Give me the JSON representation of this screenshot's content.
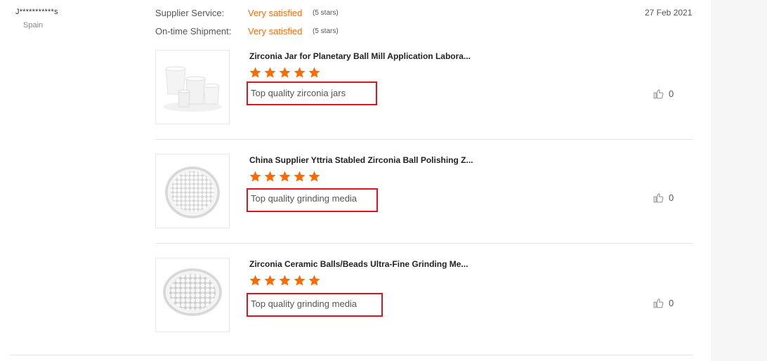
{
  "reviewer": {
    "name": "J***********s",
    "country": "Spain"
  },
  "ratings": [
    {
      "label": "Supplier Service:",
      "value": "Very satisfied",
      "note": "(5 stars)"
    },
    {
      "label": "On-time Shipment:",
      "value": "Very satisfied",
      "note": "(5 stars)"
    }
  ],
  "date": "27 Feb 2021",
  "colors": {
    "accent": "#ff6a00",
    "highlight_border": "#e0141e"
  },
  "products": [
    {
      "title": "Zirconia Jar for Planetary Ball Mill Application Labora...",
      "stars": 5,
      "comment": "Top quality zirconia jars",
      "likes": "0",
      "image": "zirconia-jars-image"
    },
    {
      "title": "China Supplier Yttria Stabled Zirconia Ball Polishing Z...",
      "stars": 5,
      "comment": "Top quality grinding media",
      "likes": "0",
      "image": "zirconia-balls-dish-image"
    },
    {
      "title": "Zirconia Ceramic Balls/Beads Ultra-Fine Grinding Me...",
      "stars": 5,
      "comment": "Top quality grinding media",
      "likes": "0",
      "image": "zirconia-beads-dish-image"
    }
  ]
}
